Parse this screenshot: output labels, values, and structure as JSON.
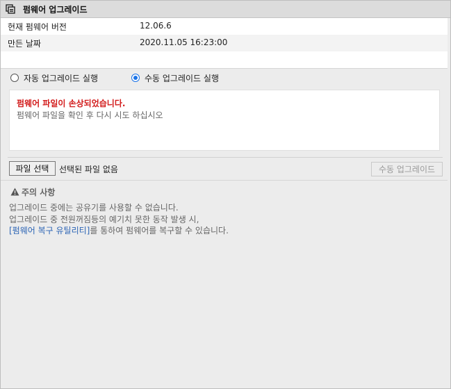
{
  "window": {
    "title": "펌웨어 업그레이드",
    "icon": "firmware-upgrade-icon"
  },
  "info": {
    "rows": [
      {
        "label": "현재 펌웨어 버전",
        "value": "12.06.6"
      },
      {
        "label": "만든 날짜",
        "value": "2020.11.05 16:23:00"
      }
    ]
  },
  "mode": {
    "auto_label": "자동 업그레이드 실행",
    "manual_label": "수동 업그레이드 실행",
    "selected": "manual"
  },
  "message": {
    "error": "펌웨어 파일이 손상되었습니다.",
    "hint": "펌웨어 파일을 확인 후 다시 시도 하십시오"
  },
  "file": {
    "choose_label": "파일 선택",
    "status": "선택된 파일 없음"
  },
  "manual_button": "수동 업그레이드",
  "notice": {
    "icon": "warning-icon",
    "title": "주의 사항",
    "line1": "업그레이드 중에는 공유기를 사용할 수 없습니다.",
    "line2": "업그레이드 중 전원꺼짐등의 예기치 못한 동작 발생 시,",
    "link": "[펌웨어 복구 유틸리티]",
    "line3_rest": "를 통하여 펌웨어를 복구할 수 있습니다."
  },
  "colors": {
    "error": "#d21b1b",
    "link": "#2b64b5",
    "radio_selected": "#1a73e8"
  }
}
